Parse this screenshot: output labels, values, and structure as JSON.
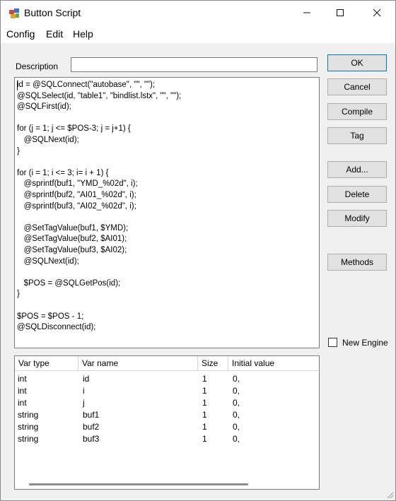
{
  "window": {
    "title": "Button Script",
    "controls": {
      "minimize": "—",
      "maximize": "☐",
      "close": "✕"
    }
  },
  "menu": [
    "Config",
    "Edit",
    "Help"
  ],
  "description": {
    "label": "Description",
    "value": ""
  },
  "code": [
    "id = @SQLConnect(\"autobase\", \"\", \"\");",
    "@SQLSelect(id, \"table1\", \"bindlist.lstx\", \"\", \"\");",
    "@SQLFirst(id);",
    "",
    "for (j = 1; j <= $POS-3; j = j+1) {",
    "   @SQLNext(id);",
    "}",
    "",
    "for (i = 1; i <= 3; i= i + 1) {",
    "   @sprintf(buf1, \"YMD_%02d\", i);",
    "   @sprintf(buf2, \"AI01_%02d\", i);",
    "   @sprintf(buf3, \"AI02_%02d\", i);",
    "",
    "   @SetTagValue(buf1, $YMD);",
    "   @SetTagValue(buf2, $AI01);",
    "   @SetTagValue(buf3, $AI02);",
    "   @SQLNext(id);",
    "",
    "   $POS = @SQLGetPos(id);",
    "}",
    "",
    "$POS = $POS - 1;",
    "@SQLDisconnect(id);"
  ],
  "variables": {
    "columns": [
      "Var type",
      "Var name",
      "Size",
      "Initial value"
    ],
    "rows": [
      {
        "type": "int",
        "name": "id",
        "size": "1",
        "init": "0,"
      },
      {
        "type": "int",
        "name": "i",
        "size": "1",
        "init": "0,"
      },
      {
        "type": "int",
        "name": "j",
        "size": "1",
        "init": "0,"
      },
      {
        "type": "string",
        "name": "buf1",
        "size": "1",
        "init": "0,"
      },
      {
        "type": "string",
        "name": "buf2",
        "size": "1",
        "init": "0,"
      },
      {
        "type": "string",
        "name": "buf3",
        "size": "1",
        "init": "0,"
      }
    ]
  },
  "buttons": {
    "ok": "OK",
    "cancel": "Cancel",
    "compile": "Compile",
    "tag": "Tag",
    "add": "Add...",
    "delete": "Delete",
    "modify": "Modify",
    "methods": "Methods"
  },
  "new_engine": {
    "label": "New Engine",
    "checked": false
  },
  "colors": {
    "window_bg": "#f0f0f0",
    "button_bg": "#e1e1e1",
    "focus_border": "#0078d7"
  }
}
